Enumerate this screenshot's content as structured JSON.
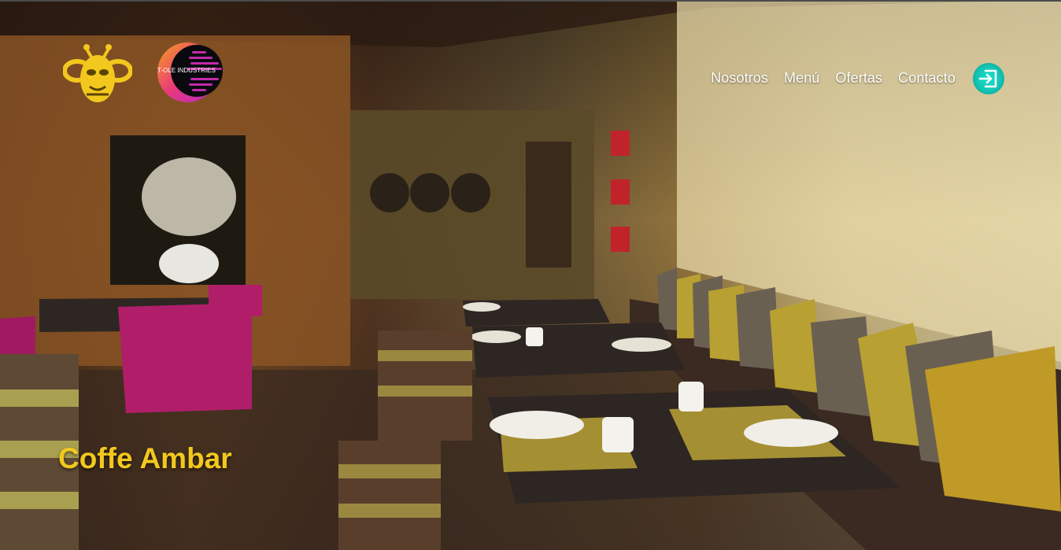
{
  "nav": {
    "links": [
      "Nosotros",
      "Menú",
      "Ofertas",
      "Contacto"
    ]
  },
  "logos": {
    "partner_text": "T-OLE INDUSTRIES"
  },
  "hero": {
    "title": "Coffe Ambar"
  },
  "colors": {
    "accent_yellow": "#f3c81e",
    "login_teal": "#1de3d0",
    "partner_magenta": "#e0309a"
  },
  "icons": {
    "login": "login-arrow-icon",
    "brand": "bee-icon"
  }
}
